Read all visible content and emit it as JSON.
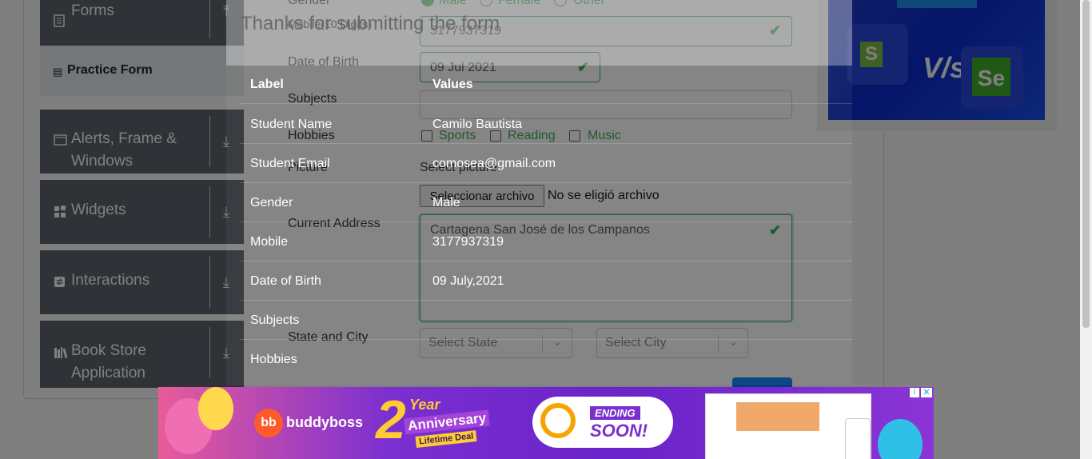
{
  "sidebar": {
    "groups": [
      {
        "label": "Forms",
        "icon": "file-icon",
        "arrow": "up"
      },
      {
        "label": "Alerts, Frame &",
        "label2": "Windows",
        "icon": "window-icon",
        "arrow": "down"
      },
      {
        "label": "Widgets",
        "icon": "widgets-icon",
        "arrow": "down"
      },
      {
        "label": "Interactions",
        "icon": "interactions-icon",
        "arrow": "down"
      },
      {
        "label": "Book Store",
        "label2": "Application",
        "icon": "books-icon",
        "arrow": "down"
      }
    ],
    "active_item": "Practice Form"
  },
  "form": {
    "gender_label": "Gender",
    "gender_options": [
      "Male",
      "Female",
      "Other"
    ],
    "mobile_label": "Mobile(10 Digits)",
    "mobile_value": "3177937319",
    "dob_label": "Date of Birth",
    "dob_value": "09 Jul 2021",
    "subjects_label": "Subjects",
    "hobbies_label": "Hobbies",
    "hobbies": [
      "Sports",
      "Reading",
      "Music"
    ],
    "picture_label": "Picture",
    "picture_prompt": "Select picture",
    "file_button": "Seleccionar archivo",
    "file_status": "No se eligió archivo",
    "address_label": "Current Address",
    "address_value": "Cartagena San José de los Campanos",
    "state_city_label": "State and City",
    "state_placeholder": "Select State",
    "city_placeholder": "Select City"
  },
  "modal": {
    "title": "Thanks for submitting the form",
    "headers": {
      "label": "Label",
      "values": "Values"
    },
    "rows": [
      {
        "label": "Student Name",
        "value": "Camilo Bautista"
      },
      {
        "label": "Student Email",
        "value": "comosea@gmail.com"
      },
      {
        "label": "Gender",
        "value": "Male"
      },
      {
        "label": "Mobile",
        "value": "3177937319"
      },
      {
        "label": "Date of Birth",
        "value": "09 July,2021"
      },
      {
        "label": "Subjects",
        "value": ""
      },
      {
        "label": "Hobbies",
        "value": ""
      }
    ]
  },
  "ad_banner": {
    "brand": "buddyboss",
    "anniversary_number": "2",
    "anniversary_word1": "Year",
    "anniversary_word2": "Anniversary",
    "anniversary_word3": "Lifetime Deal",
    "ending_word1": "ENDING",
    "ending_word2": "SOON!"
  },
  "ad_image": {
    "vs_text": "V/s",
    "se_text": "Se",
    "s_text": "S"
  },
  "colors": {
    "accent_green": "#28a745",
    "sidebar_bg": "#5e6670",
    "banner_purple": "#6a23c9",
    "ad_blue": "#0a2bd0"
  }
}
